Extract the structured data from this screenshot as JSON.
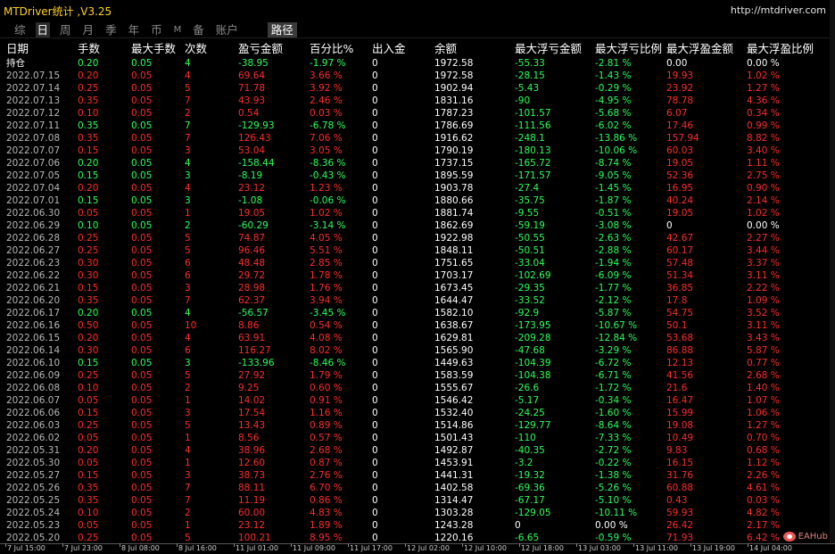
{
  "app": {
    "title": "MTDriver统计 ,V3.25",
    "url": "http://mtdriver.com"
  },
  "tabs": [
    {
      "label": "综",
      "active": false
    },
    {
      "label": "日",
      "active": true
    },
    {
      "label": "周",
      "active": false
    },
    {
      "label": "月",
      "active": false
    },
    {
      "label": "季",
      "active": false
    },
    {
      "label": "年",
      "active": false
    },
    {
      "label": "币",
      "active": false
    },
    {
      "label": "M",
      "active": false
    },
    {
      "label": "备",
      "active": false
    },
    {
      "label": "账户",
      "active": false
    }
  ],
  "path_button": "路径",
  "columns": [
    "日期",
    "手数",
    "最大手数",
    "次数",
    "盈亏金额",
    "百分比%",
    "出入金",
    "余额",
    "最大浮亏金额",
    "最大浮亏比例",
    "最大浮盈金额",
    "最大浮盈比例"
  ],
  "rows": [
    [
      "持仓",
      "0.20",
      "0.05",
      "4",
      "-38.95",
      "-1.97 %",
      "0",
      "1972.58",
      "-55.33",
      "-2.81 %",
      "0.00",
      "0.00 %"
    ],
    [
      "2022.07.15",
      "0.20",
      "0.05",
      "4",
      "69.64",
      "3.66 %",
      "0",
      "1972.58",
      "-28.15",
      "-1.43 %",
      "19.93",
      "1.02 %"
    ],
    [
      "2022.07.14",
      "0.25",
      "0.05",
      "5",
      "71.78",
      "3.92 %",
      "0",
      "1902.94",
      "-5.43",
      "-0.29 %",
      "23.92",
      "1.27 %"
    ],
    [
      "2022.07.13",
      "0.35",
      "0.05",
      "7",
      "43.93",
      "2.46 %",
      "0",
      "1831.16",
      "-90",
      "-4.95 %",
      "78.78",
      "4.36 %"
    ],
    [
      "2022.07.12",
      "0.10",
      "0.05",
      "2",
      "0.54",
      "0.03 %",
      "0",
      "1787.23",
      "-101.57",
      "-5.68 %",
      "6.07",
      "0.34 %"
    ],
    [
      "2022.07.11",
      "0.35",
      "0.05",
      "7",
      "-129.93",
      "-6.78 %",
      "0",
      "1786.69",
      "-111.56",
      "-6.02 %",
      "17.46",
      "0.99 %"
    ],
    [
      "2022.07.08",
      "0.35",
      "0.05",
      "7",
      "126.43",
      "7.06 %",
      "0",
      "1916.62",
      "-248.1",
      "-13.86 %",
      "157.94",
      "8.82 %"
    ],
    [
      "2022.07.07",
      "0.15",
      "0.05",
      "3",
      "53.04",
      "3.05 %",
      "0",
      "1790.19",
      "-180.13",
      "-10.06 %",
      "60.03",
      "3.40 %"
    ],
    [
      "2022.07.06",
      "0.20",
      "0.05",
      "4",
      "-158.44",
      "-8.36 %",
      "0",
      "1737.15",
      "-165.72",
      "-8.74 %",
      "19.05",
      "1.11 %"
    ],
    [
      "2022.07.05",
      "0.15",
      "0.05",
      "3",
      "-8.19",
      "-0.43 %",
      "0",
      "1895.59",
      "-171.57",
      "-9.05 %",
      "52.36",
      "2.75 %"
    ],
    [
      "2022.07.04",
      "0.20",
      "0.05",
      "4",
      "23.12",
      "1.23 %",
      "0",
      "1903.78",
      "-27.4",
      "-1.45 %",
      "16.95",
      "0.90 %"
    ],
    [
      "2022.07.01",
      "0.15",
      "0.05",
      "3",
      "-1.08",
      "-0.06 %",
      "0",
      "1880.66",
      "-35.75",
      "-1.87 %",
      "40.24",
      "2.14 %"
    ],
    [
      "2022.06.30",
      "0.05",
      "0.05",
      "1",
      "19.05",
      "1.02 %",
      "0",
      "1881.74",
      "-9.55",
      "-0.51 %",
      "19.05",
      "1.02 %"
    ],
    [
      "2022.06.29",
      "0.10",
      "0.05",
      "2",
      "-60.29",
      "-3.14 %",
      "0",
      "1862.69",
      "-59.19",
      "-3.08 %",
      "0",
      "0.00 %"
    ],
    [
      "2022.06.28",
      "0.25",
      "0.05",
      "5",
      "74.87",
      "4.05 %",
      "0",
      "1922.98",
      "-50.55",
      "-2.63 %",
      "42.67",
      "2.27 %"
    ],
    [
      "2022.06.27",
      "0.25",
      "0.05",
      "5",
      "96.46",
      "5.51 %",
      "0",
      "1848.11",
      "-50.51",
      "-2.88 %",
      "60.17",
      "3.44 %"
    ],
    [
      "2022.06.23",
      "0.30",
      "0.05",
      "6",
      "48.48",
      "2.85 %",
      "0",
      "1751.65",
      "-33.04",
      "-1.94 %",
      "57.48",
      "3.37 %"
    ],
    [
      "2022.06.22",
      "0.30",
      "0.05",
      "6",
      "29.72",
      "1.78 %",
      "0",
      "1703.17",
      "-102.69",
      "-6.09 %",
      "51.34",
      "3.11 %"
    ],
    [
      "2022.06.21",
      "0.15",
      "0.05",
      "3",
      "28.98",
      "1.76 %",
      "0",
      "1673.45",
      "-29.35",
      "-1.77 %",
      "36.85",
      "2.22 %"
    ],
    [
      "2022.06.20",
      "0.35",
      "0.05",
      "7",
      "62.37",
      "3.94 %",
      "0",
      "1644.47",
      "-33.52",
      "-2.12 %",
      "17.8",
      "1.09 %"
    ],
    [
      "2022.06.17",
      "0.20",
      "0.05",
      "4",
      "-56.57",
      "-3.45 %",
      "0",
      "1582.10",
      "-92.9",
      "-5.87 %",
      "54.75",
      "3.52 %"
    ],
    [
      "2022.06.16",
      "0.50",
      "0.05",
      "10",
      "8.86",
      "0.54 %",
      "0",
      "1638.67",
      "-173.95",
      "-10.67 %",
      "50.1",
      "3.11 %"
    ],
    [
      "2022.06.15",
      "0.20",
      "0.05",
      "4",
      "63.91",
      "4.08 %",
      "0",
      "1629.81",
      "-209.28",
      "-12.84 %",
      "53.68",
      "3.43 %"
    ],
    [
      "2022.06.14",
      "0.30",
      "0.05",
      "6",
      "116.27",
      "8.02 %",
      "0",
      "1565.90",
      "-47.68",
      "-3.29 %",
      "86.88",
      "5.87 %"
    ],
    [
      "2022.06.10",
      "0.15",
      "0.05",
      "3",
      "-133.96",
      "-8.46 %",
      "0",
      "1449.63",
      "-104.39",
      "-6.72 %",
      "12.13",
      "0.77 %"
    ],
    [
      "2022.06.09",
      "0.25",
      "0.05",
      "5",
      "27.92",
      "1.79 %",
      "0",
      "1583.59",
      "-104.38",
      "-6.71 %",
      "41.56",
      "2.68 %"
    ],
    [
      "2022.06.08",
      "0.10",
      "0.05",
      "2",
      "9.25",
      "0.60 %",
      "0",
      "1555.67",
      "-26.6",
      "-1.72 %",
      "21.6",
      "1.40 %"
    ],
    [
      "2022.06.07",
      "0.05",
      "0.05",
      "1",
      "14.02",
      "0.91 %",
      "0",
      "1546.42",
      "-5.17",
      "-0.34 %",
      "16.47",
      "1.07 %"
    ],
    [
      "2022.06.06",
      "0.15",
      "0.05",
      "3",
      "17.54",
      "1.16 %",
      "0",
      "1532.40",
      "-24.25",
      "-1.60 %",
      "15.99",
      "1.06 %"
    ],
    [
      "2022.06.03",
      "0.25",
      "0.05",
      "5",
      "13.43",
      "0.89 %",
      "0",
      "1514.86",
      "-129.77",
      "-8.64 %",
      "19.08",
      "1.27 %"
    ],
    [
      "2022.06.02",
      "0.05",
      "0.05",
      "1",
      "8.56",
      "0.57 %",
      "0",
      "1501.43",
      "-110",
      "-7.33 %",
      "10.49",
      "0.70 %"
    ],
    [
      "2022.05.31",
      "0.20",
      "0.05",
      "4",
      "38.96",
      "2.68 %",
      "0",
      "1492.87",
      "-40.35",
      "-2.72 %",
      "9.83",
      "0.68 %"
    ],
    [
      "2022.05.30",
      "0.05",
      "0.05",
      "1",
      "12.60",
      "0.87 %",
      "0",
      "1453.91",
      "-3.2",
      "-0.22 %",
      "16.15",
      "1.12 %"
    ],
    [
      "2022.05.27",
      "0.15",
      "0.05",
      "3",
      "38.73",
      "2.76 %",
      "0",
      "1441.31",
      "-19.32",
      "-1.38 %",
      "31.76",
      "2.26 %"
    ],
    [
      "2022.05.26",
      "0.35",
      "0.05",
      "7",
      "88.11",
      "6.70 %",
      "0",
      "1402.58",
      "-69.36",
      "-5.26 %",
      "60.88",
      "4.61 %"
    ],
    [
      "2022.05.25",
      "0.35",
      "0.05",
      "7",
      "11.19",
      "0.86 %",
      "0",
      "1314.47",
      "-67.17",
      "-5.10 %",
      "0.43",
      "0.03 %"
    ],
    [
      "2022.05.24",
      "0.10",
      "0.05",
      "2",
      "60.00",
      "4.83 %",
      "0",
      "1303.28",
      "-129.05",
      "-10.11 %",
      "59.93",
      "4.82 %"
    ],
    [
      "2022.05.23",
      "0.05",
      "0.05",
      "1",
      "23.12",
      "1.89 %",
      "0",
      "1243.28",
      "0",
      "0.00 %",
      "26.42",
      "2.17 %"
    ],
    [
      "2022.05.20",
      "0.25",
      "0.05",
      "5",
      "100.21",
      "8.95 %",
      "0",
      "1220.16",
      "-6.65",
      "-0.59 %",
      "71.93",
      "6.42 %"
    ]
  ],
  "colors": {
    "positive": "#ff2b2b",
    "negative": "#2bff5b",
    "neutral": "#ffffff",
    "title": "#ffd21f",
    "background": "#000000"
  },
  "time_axis": [
    "7 Jul 15:00",
    "7 Jul 23:00",
    "8 Jul 08:00",
    "8 Jul 16:00",
    "11 Jul 01:00",
    "11 Jul 09:00",
    "11 Jul 17:00",
    "12 Jul 02:00",
    "12 Jul 10:00",
    "12 Jul 18:00",
    "13 Jul 03:00",
    "13 Jul 11:00",
    "13 Jul 19:00",
    "14 Jul 04:00"
  ],
  "watermark": {
    "icon": "eahub-logo-icon",
    "text": "EAHub"
  }
}
